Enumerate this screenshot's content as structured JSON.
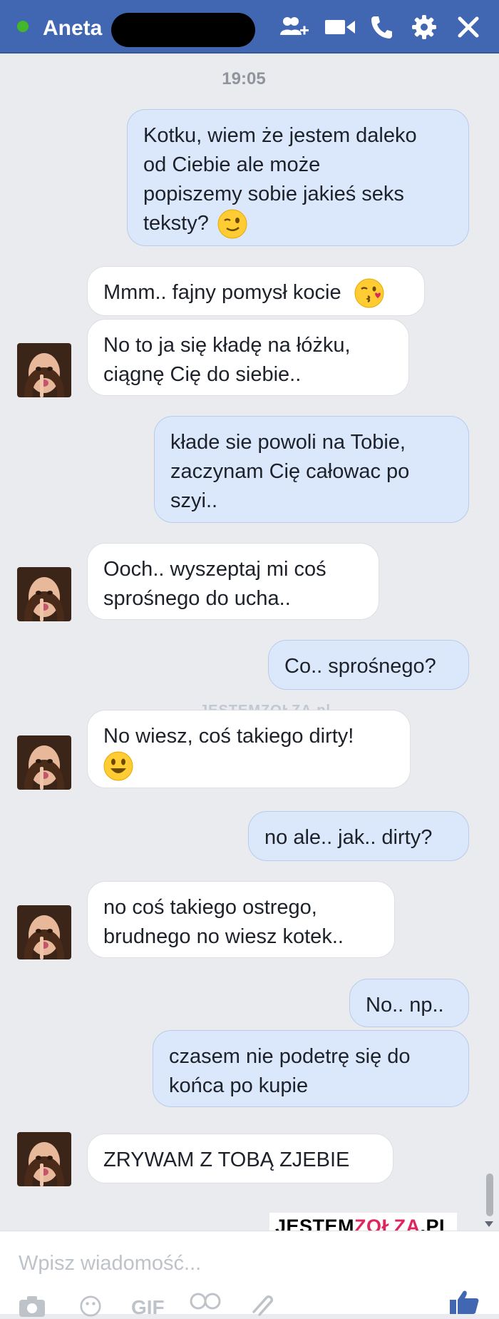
{
  "header": {
    "contact_name": "Aneta",
    "status_color": "#42b72a",
    "accent": "#4267b2",
    "icons": [
      "add-people-icon",
      "video-call-icon",
      "phone-icon",
      "gear-icon",
      "close-icon"
    ]
  },
  "chat": {
    "timestamp": "19:05",
    "messages": [
      {
        "from": "me",
        "lines": [
          "Kotku, wiem że jestem daleko",
          "od Ciebie ale może",
          "popiszemy sobie jakieś seks",
          "teksty?"
        ],
        "emoji": "winking-face"
      },
      {
        "from": "Aneta",
        "lines": [
          "Mmm.. fajny pomysł kocie"
        ],
        "emoji": "kissing-face"
      },
      {
        "from": "Aneta",
        "lines": [
          "No to ja się kładę na łóżku,",
          "ciągnę Cię do siebie.."
        ]
      },
      {
        "from": "me",
        "lines": [
          "kłade sie powoli na Tobie,",
          "zaczynam Cię całowac po",
          "szyi.."
        ]
      },
      {
        "from": "Aneta",
        "lines": [
          "Ooch.. wyszeptaj mi coś",
          "sprośnego do ucha.."
        ]
      },
      {
        "from": "me",
        "lines": [
          "Co.. sprośnego?"
        ]
      },
      {
        "from": "Aneta",
        "lines": [
          "No wiesz, coś takiego dirty!"
        ],
        "emoji": "smiling-face"
      },
      {
        "from": "me",
        "lines": [
          "no ale.. jak.. dirty?"
        ]
      },
      {
        "from": "Aneta",
        "lines": [
          "no coś takiego ostrego,",
          "brudnego no wiesz kotek.."
        ]
      },
      {
        "from": "me",
        "lines": [
          "No.. np.."
        ]
      },
      {
        "from": "me",
        "lines": [
          "czasem nie podetrę się do",
          "końca po kupie"
        ]
      },
      {
        "from": "Aneta",
        "lines": [
          "ZRYWAM Z TOBĄ ZJEBIE"
        ]
      }
    ]
  },
  "watermark": {
    "mid": "JESTEMZOŁZA.pl",
    "logo_prefix": "JESTEM",
    "logo_accent": "ZOŁZA",
    "logo_suffix": ".PL"
  },
  "composer": {
    "placeholder": "Wpisz wiadomość...",
    "value": "",
    "tools": [
      "camera-icon",
      "emoji-icon",
      "GIF",
      "sticker-icon",
      "attachment-icon",
      "like-icon"
    ]
  }
}
